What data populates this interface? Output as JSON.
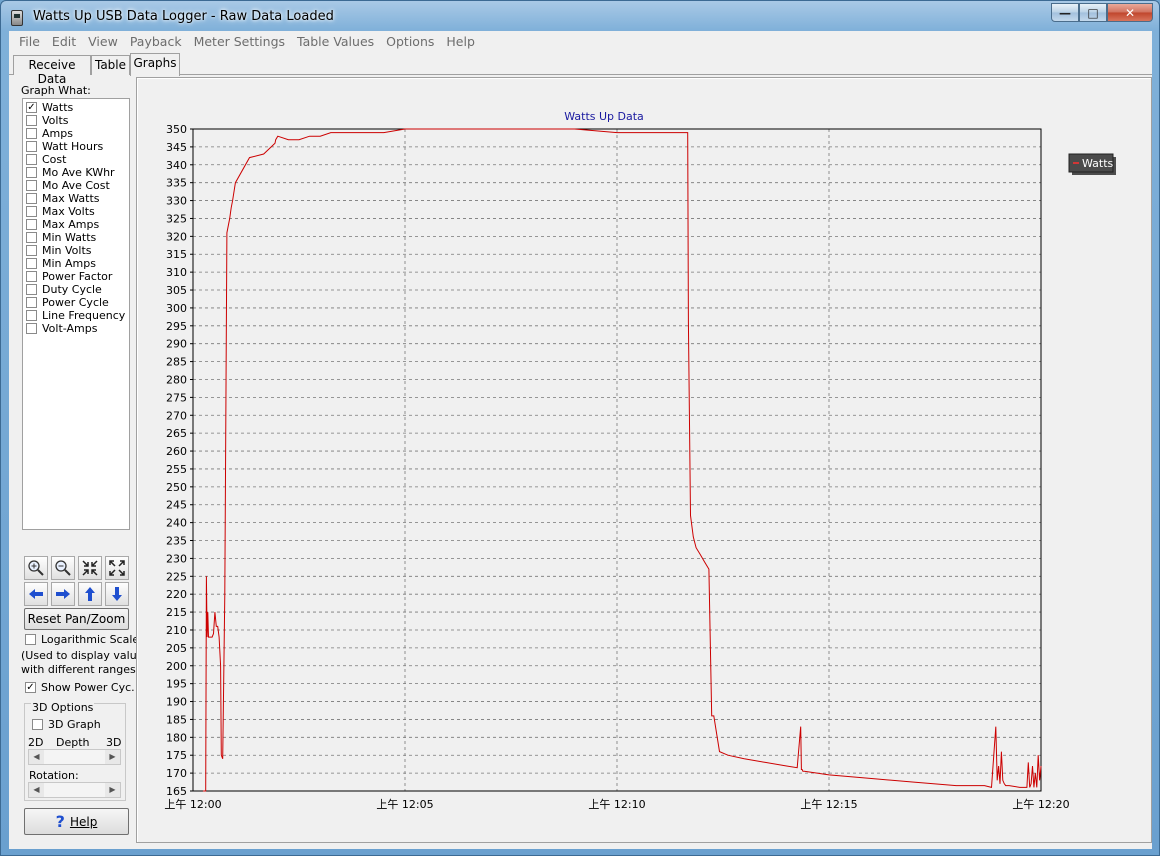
{
  "window": {
    "title": "Watts Up USB Data Logger - Raw Data Loaded"
  },
  "menu": [
    "File",
    "Edit",
    "View",
    "Payback",
    "Meter Settings",
    "Table Values",
    "Options",
    "Help"
  ],
  "tabs": [
    {
      "label": "Receive Data",
      "active": false
    },
    {
      "label": "Table",
      "active": false
    },
    {
      "label": "Graphs",
      "active": true
    }
  ],
  "left_panel": {
    "graph_what_label": "Graph What:",
    "options": [
      {
        "label": "Watts",
        "checked": true
      },
      {
        "label": "Volts",
        "checked": false
      },
      {
        "label": "Amps",
        "checked": false
      },
      {
        "label": "Watt Hours",
        "checked": false
      },
      {
        "label": "Cost",
        "checked": false
      },
      {
        "label": "Mo Ave KWhr",
        "checked": false
      },
      {
        "label": "Mo Ave Cost",
        "checked": false
      },
      {
        "label": "Max Watts",
        "checked": false
      },
      {
        "label": "Max Volts",
        "checked": false
      },
      {
        "label": "Max Amps",
        "checked": false
      },
      {
        "label": "Min Watts",
        "checked": false
      },
      {
        "label": "Min Volts",
        "checked": false
      },
      {
        "label": "Min Amps",
        "checked": false
      },
      {
        "label": "Power Factor",
        "checked": false
      },
      {
        "label": "Duty Cycle",
        "checked": false
      },
      {
        "label": "Power Cycle",
        "checked": false
      },
      {
        "label": "Line Frequency",
        "checked": false
      },
      {
        "label": "Volt-Amps",
        "checked": false
      }
    ],
    "reset_label": "Reset Pan/Zoom",
    "log_scales_label": "Logarithmic Scales",
    "log_scales_checked": false,
    "log_note_1": "(Used to display values",
    "log_note_2": "with different ranges.)",
    "show_power_label": "Show Power Cyc.",
    "show_power_checked": true,
    "three_d_title": "3D Options",
    "three_d_graph_label": "3D Graph",
    "three_d_graph_checked": false,
    "depth_2d": "2D",
    "depth_label": "Depth",
    "depth_3d": "3D",
    "rotation_label": "Rotation:",
    "help_label": "Help"
  },
  "chart_data": {
    "type": "line",
    "title": "Watts Up Data",
    "line_color": "#cc0000",
    "grid": true,
    "legend": {
      "position": "right",
      "entries": [
        "Watts"
      ]
    },
    "ylim": [
      165,
      350
    ],
    "y_ticks": [
      165,
      170,
      175,
      180,
      185,
      190,
      195,
      200,
      205,
      210,
      215,
      220,
      225,
      230,
      235,
      240,
      245,
      250,
      255,
      260,
      265,
      270,
      275,
      280,
      285,
      290,
      295,
      300,
      305,
      310,
      315,
      320,
      325,
      330,
      335,
      340,
      345,
      350
    ],
    "xlim": [
      "12:00",
      "12:20"
    ],
    "x_ticks": [
      "上午 12:00",
      "上午 12:05",
      "上午 12:10",
      "上午 12:15",
      "上午 12:20"
    ],
    "series": [
      {
        "name": "Watts",
        "x": [
          "12:00:14",
          "12:00:18",
          "12:00:19",
          "12:00:20",
          "12:00:21",
          "12:00:22",
          "12:00:24",
          "12:00:27",
          "12:00:29",
          "12:00:31",
          "12:00:33",
          "12:00:35",
          "12:00:37",
          "12:00:39",
          "12:00:40",
          "12:00:42",
          "12:00:45",
          "12:00:48",
          "12:00:50",
          "12:00:52",
          "12:00:54",
          "12:00:56",
          "12:01:00",
          "12:01:20",
          "12:01:40",
          "12:01:56",
          "12:01:57",
          "12:02:00",
          "12:02:15",
          "12:02:30",
          "12:02:45",
          "12:03:00",
          "12:03:15",
          "12:03:30",
          "12:04:00",
          "12:04:30",
          "12:05:00",
          "12:06:00",
          "12:07:00",
          "12:08:00",
          "12:09:00",
          "12:10:00",
          "12:11:00",
          "12:11:40",
          "12:11:41",
          "12:11:44",
          "12:11:48",
          "12:11:52",
          "12:11:58",
          "12:12:04",
          "12:12:10",
          "12:12:14",
          "12:12:17",
          "12:12:25",
          "12:12:37",
          "12:13:00",
          "12:13:30",
          "12:14:00",
          "12:14:15",
          "12:14:20",
          "12:14:21",
          "12:14:22",
          "12:14:23",
          "12:14:25",
          "12:15:00",
          "12:16:00",
          "12:17:00",
          "12:18:00",
          "12:18:40",
          "12:18:50",
          "12:18:56",
          "12:18:58",
          "12:19:00",
          "12:19:02",
          "12:19:04",
          "12:19:06",
          "12:19:08",
          "12:19:10",
          "12:19:15",
          "12:19:30",
          "12:19:40",
          "12:19:42",
          "12:19:44",
          "12:19:46",
          "12:19:48",
          "12:19:50",
          "12:19:52",
          "12:19:54",
          "12:19:56",
          "12:19:58",
          "12:20:00"
        ],
        "values": [
          165,
          165,
          225,
          208,
          215,
          208,
          208,
          208,
          209,
          215,
          211,
          211,
          208,
          200,
          175,
          174,
          220,
          321,
          323,
          325,
          328,
          330,
          335,
          342,
          343,
          346,
          347,
          348,
          347,
          347,
          348,
          348,
          349,
          349,
          349,
          349,
          350,
          350,
          350,
          350,
          350,
          349,
          349,
          349,
          296,
          242,
          236,
          233,
          231,
          229,
          227,
          186,
          186,
          176,
          175,
          174,
          173,
          172,
          171.5,
          183,
          171,
          171,
          170.5,
          170.5,
          169.5,
          168.5,
          167.5,
          166.5,
          166.5,
          166,
          183,
          168,
          172,
          167,
          176,
          168,
          167,
          166.5,
          166.5,
          166,
          166,
          173,
          166,
          167,
          172,
          166,
          170,
          166,
          175,
          168,
          172
        ]
      }
    ]
  }
}
